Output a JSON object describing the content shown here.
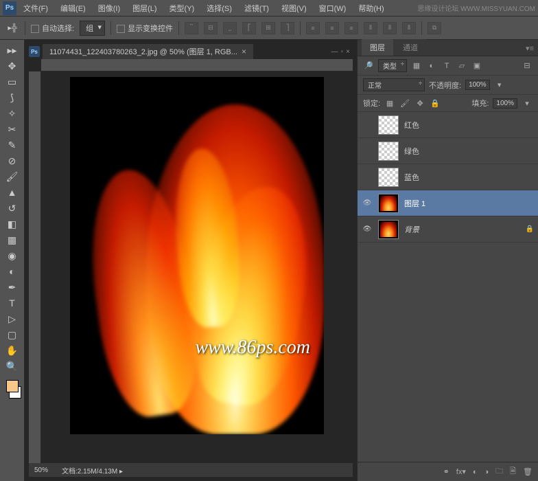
{
  "menubar": {
    "items": [
      "文件(F)",
      "编辑(E)",
      "图像(I)",
      "图层(L)",
      "类型(Y)",
      "选择(S)",
      "滤镜(T)",
      "视图(V)",
      "窗口(W)",
      "帮助(H)"
    ],
    "right_text": "思缘设计论坛 WWW.MISSYUAN.COM"
  },
  "options": {
    "auto_select_label": "自动选择:",
    "auto_select_value": "组",
    "show_transform_label": "显示变换控件"
  },
  "document": {
    "tab_title": "11074431_122403780263_2.jpg @ 50% (图层 1, RGB...",
    "zoom": "50%",
    "file_info_label": "文档:",
    "file_info": "2.15M/4.13M"
  },
  "watermark": "www.86ps.com",
  "panels": {
    "tabs": [
      "图层",
      "通道"
    ],
    "filter_label": "类型",
    "blend_mode": "正常",
    "opacity_label": "不透明度:",
    "opacity_value": "100%",
    "lock_label": "锁定:",
    "fill_label": "填充:",
    "fill_value": "100%",
    "layers": [
      {
        "name": "红色",
        "visible": false,
        "thumb": "checker"
      },
      {
        "name": "绿色",
        "visible": false,
        "thumb": "checker"
      },
      {
        "name": "蓝色",
        "visible": false,
        "thumb": "checker"
      },
      {
        "name": "图层 1",
        "visible": true,
        "thumb": "fire",
        "selected": true
      },
      {
        "name": "背景",
        "visible": true,
        "thumb": "fire",
        "locked": true,
        "italic": true
      }
    ]
  },
  "colors": {
    "foreground": "#f5c78a",
    "background": "#ffffff"
  }
}
